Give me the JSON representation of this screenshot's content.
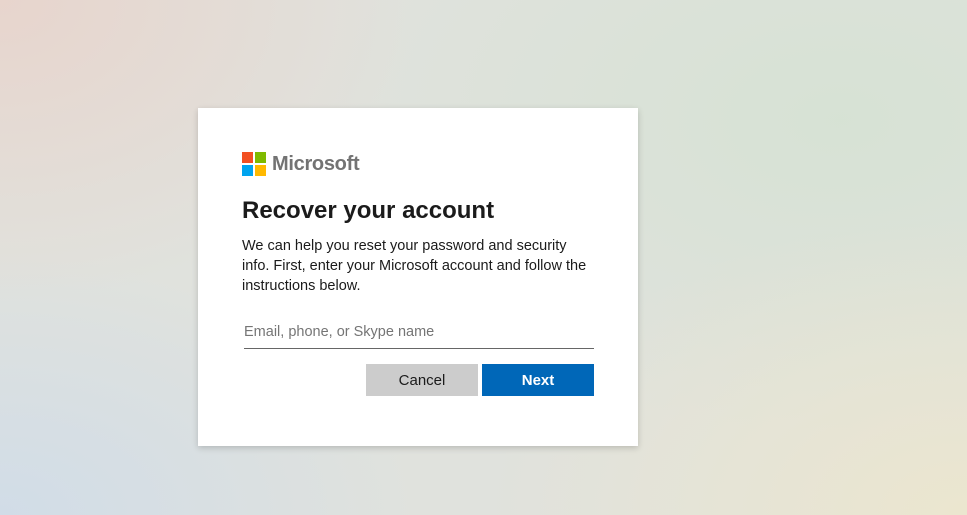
{
  "brand": {
    "name": "Microsoft",
    "logo_colors": [
      "#f25022",
      "#7fba00",
      "#00a4ef",
      "#ffb900"
    ]
  },
  "form": {
    "title": "Recover your account",
    "description": "We can help you reset your password and security info. First, enter your Microsoft account and follow the instructions below.",
    "input": {
      "placeholder": "Email, phone, or Skype name",
      "value": ""
    },
    "buttons": {
      "cancel_label": "Cancel",
      "next_label": "Next"
    }
  },
  "colors": {
    "primary_button": "#0067b8",
    "secondary_button": "#cccccc"
  }
}
